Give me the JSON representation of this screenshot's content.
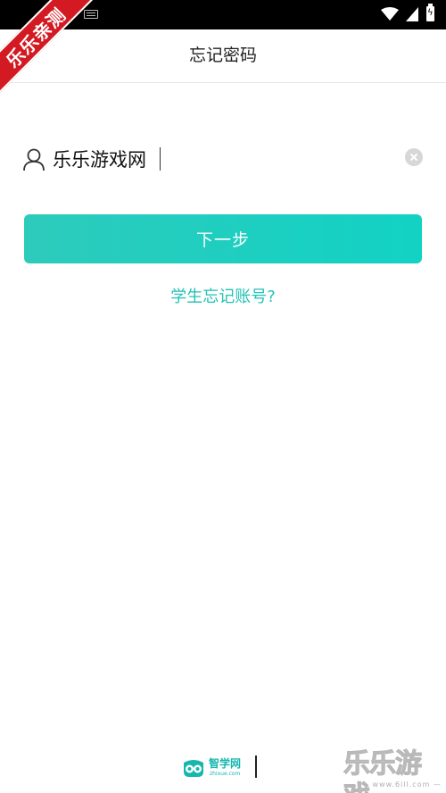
{
  "ribbon": {
    "text": "乐乐亲测"
  },
  "header": {
    "title": "忘记密码"
  },
  "account": {
    "value": "乐乐游戏网"
  },
  "next_button": {
    "label": "下一步"
  },
  "forgot_link": {
    "label": "学生忘记账号?"
  },
  "footer": {
    "logo_name": "智学网",
    "logo_domain": "zhixue.com"
  },
  "watermark": {
    "text": "乐乐游戏",
    "url": "— www.6ill.com —"
  },
  "colors": {
    "accent": "#22c2b5",
    "button_start": "#2dcbbc",
    "button_end": "#12d2c4",
    "ribbon": "#d31a23"
  }
}
